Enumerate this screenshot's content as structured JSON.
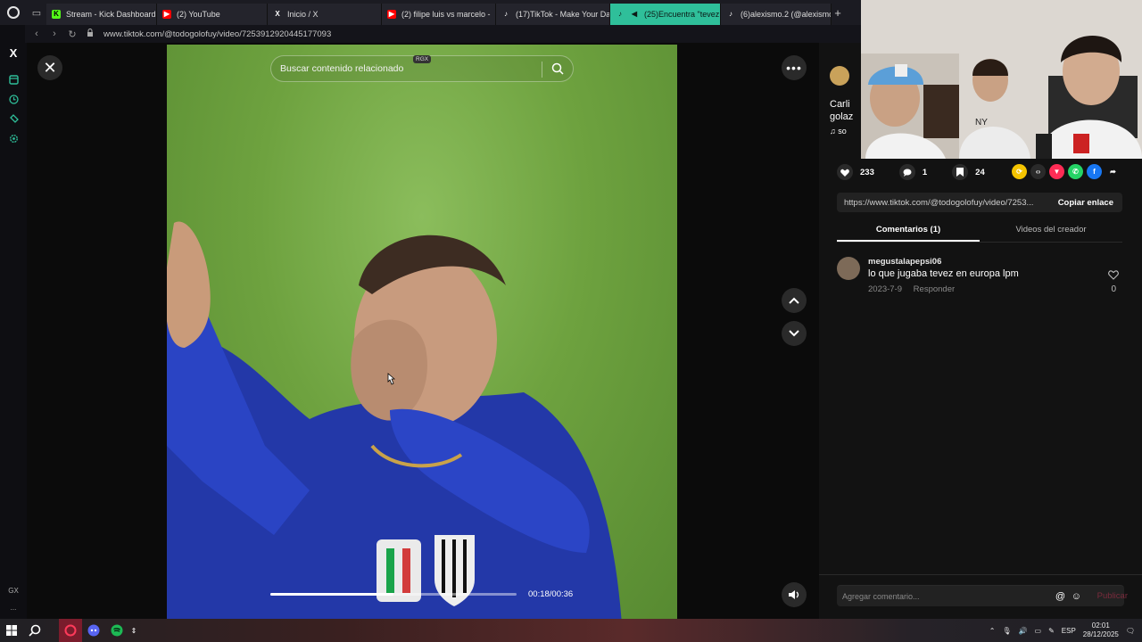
{
  "tabs": [
    {
      "label": "Stream - Kick Dashboard",
      "icon": "kick-icon",
      "color": "#53fc18",
      "glyph": "K"
    },
    {
      "label": "(2) YouTube",
      "icon": "youtube-icon",
      "color": "#ff0000",
      "glyph": "▶"
    },
    {
      "label": "Inicio / X",
      "icon": "x-icon",
      "color": "#24242c",
      "glyph": "X"
    },
    {
      "label": "(2) filipe luis vs marcelo -",
      "icon": "youtube-icon",
      "color": "#ff0000",
      "glyph": "▶"
    },
    {
      "label": "(17)TikTok - Make Your Da",
      "icon": "tiktok-icon",
      "color": "#000000",
      "glyph": "♪"
    },
    {
      "label": "(25)Encuentra \"tevez",
      "icon": "tiktok-icon",
      "color": "#000000",
      "glyph": "♪"
    },
    {
      "label": "(6)alexismo.2 (@alexismo",
      "icon": "tiktok-icon",
      "color": "#000000",
      "glyph": "♪"
    }
  ],
  "address": {
    "url": "www.tiktok.com/@todogolofuy/video/7253912920445177093"
  },
  "sidebar": {
    "bottom_label": "GX",
    "more": "..."
  },
  "video": {
    "search_placeholder": "Buscar contenido relacionado",
    "rgx_badge": "RGX",
    "time": "00:18/00:36",
    "progress": 0.5
  },
  "author": {
    "desc_line1": "Carli",
    "desc_line2": "golaz",
    "music": "so"
  },
  "stats": {
    "likes": "233",
    "comments": "1",
    "saves": "24"
  },
  "share_link": {
    "url": "https://www.tiktok.com/@todogolofuy/video/7253...",
    "copy_label": "Copiar enlace"
  },
  "right_tabs": {
    "comments": "Comentarios (1)",
    "creator_videos": "Videos del creador"
  },
  "comment": {
    "user": "megustalapepsi06",
    "text": "lo que jugaba tevez en europa lpm",
    "date": "2023-7-9",
    "reply": "Responder",
    "likes": "0"
  },
  "comment_input": {
    "placeholder": "Agregar comentario...",
    "post_label": "Publicar",
    "at": "@",
    "emoji": "☺"
  },
  "taskbar": {
    "lang": "ESP",
    "time": "02:01",
    "date": "28/12/2025"
  },
  "colors": {
    "accent": "#2fbf9a",
    "tiktok_red": "#fe2c55",
    "pitch": "#6ea23f"
  }
}
